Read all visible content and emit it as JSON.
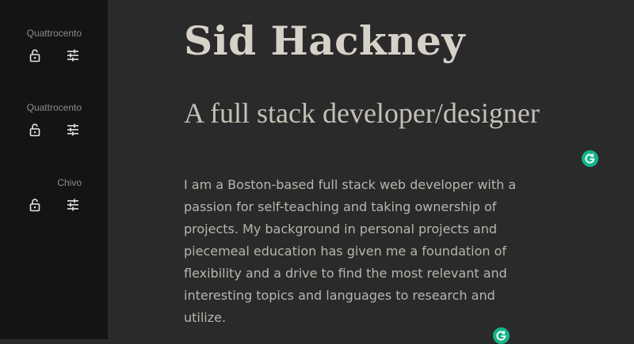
{
  "sidebar": {
    "fonts": [
      {
        "name": "Quattrocento"
      },
      {
        "name": "Quattrocento"
      },
      {
        "name": "Chivo"
      }
    ]
  },
  "main": {
    "name": "Sid Hackney",
    "tagline": "A full stack developer/designer",
    "bio": "I am a Boston-based full stack web developer with a passion for self-teaching and taking ownership of projects. My background in personal projects and piecemeal education has given me a foundation of flexibility and a drive to find the most relevant and interesting topics and languages to research and utilize."
  },
  "icons": {
    "lock": "lock-open-icon",
    "tune": "tune-sliders-icon",
    "grammarly": "grammarly-icon"
  },
  "colors": {
    "sidebar_bg": "#141414",
    "main_bg": "#2a2a2a",
    "heading": "#d6d2c8",
    "body_text": "#b8b5ad",
    "badge": "#15b48a"
  }
}
